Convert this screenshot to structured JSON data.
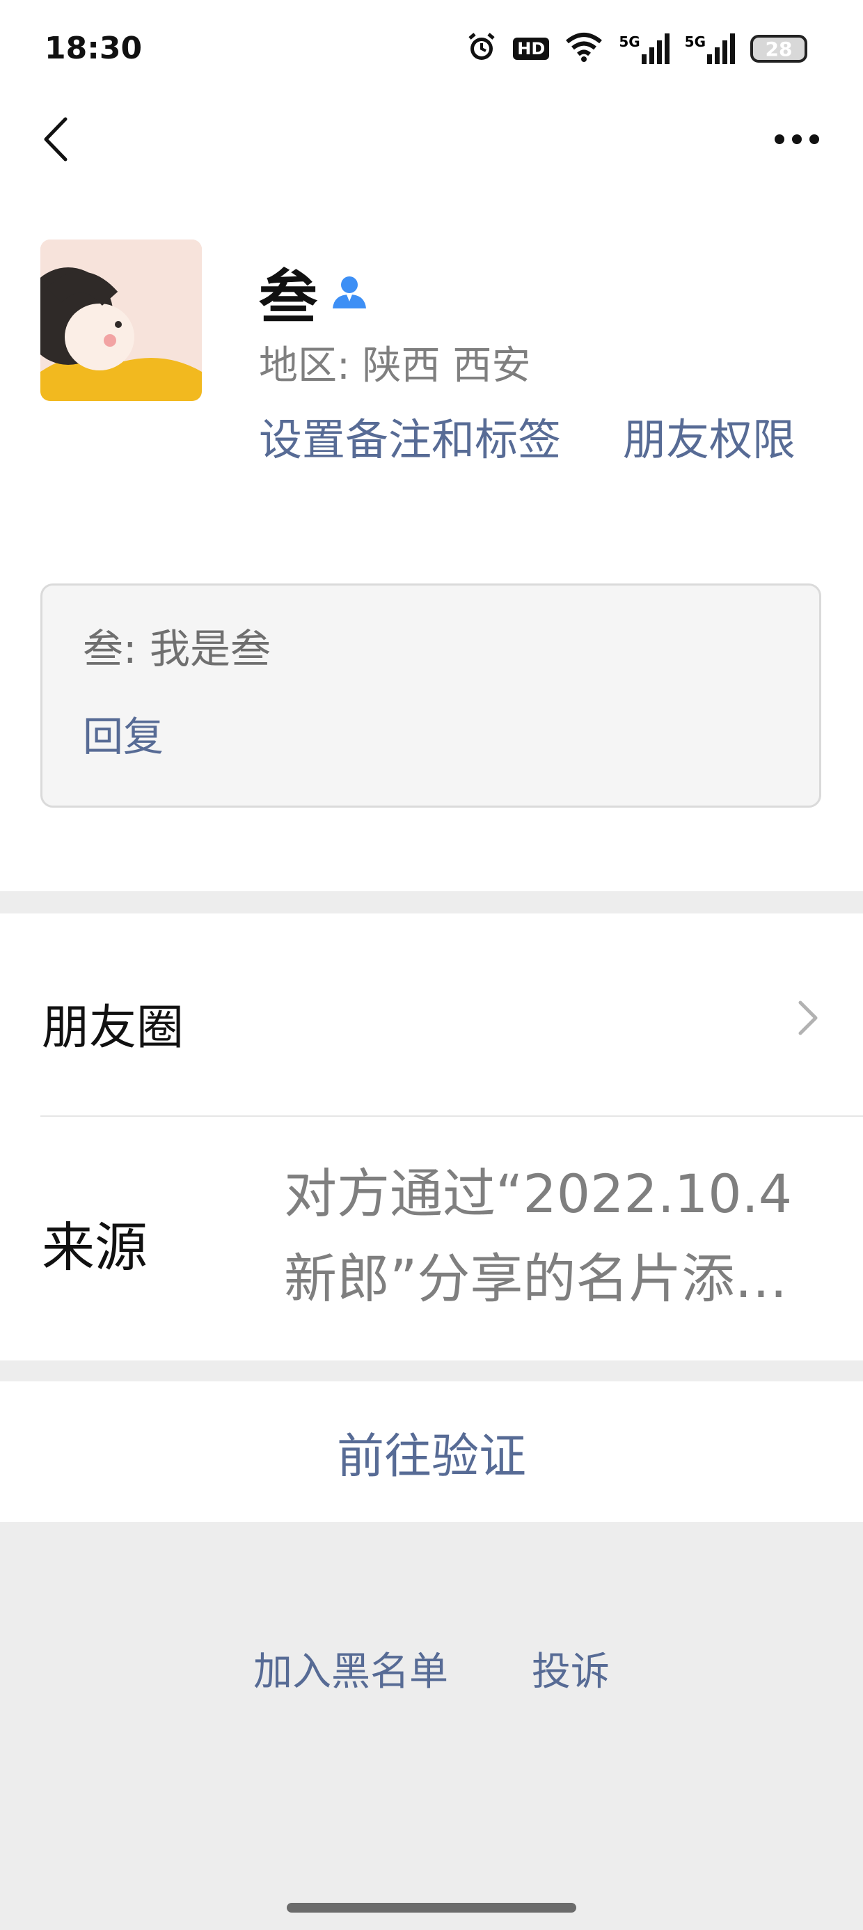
{
  "status_bar": {
    "time": "18:30",
    "hd_label": "HD",
    "signal_1_label": "5G",
    "signal_2_label": "5G",
    "battery": "28",
    "icons": [
      "alarm-icon",
      "hd-icon",
      "wifi-icon",
      "signal-5g-icon",
      "signal-5g-icon",
      "battery-icon"
    ]
  },
  "header": {
    "back_icon": "chevron-left-icon",
    "more_icon": "ellipsis-icon"
  },
  "profile": {
    "name": "叁",
    "badge_icon": "person-badge-icon",
    "region": "地区:  陕西  西安",
    "set_remark_label": "设置备注和标签",
    "friend_permission_label": "朋友权限",
    "message": {
      "text": "叁: 我是叁",
      "reply_label": "回复"
    }
  },
  "list": {
    "moments_label": "朋友圈",
    "source_label": "来源",
    "source_value": "对方通过“2022.10.4新郎”分享的名片添…"
  },
  "actions": {
    "verify_label": "前往验证",
    "blacklist_label": "加入黑名单",
    "report_label": "投诉"
  },
  "colors": {
    "link": "#576b95",
    "background": "#ededed",
    "card": "#ffffff"
  }
}
